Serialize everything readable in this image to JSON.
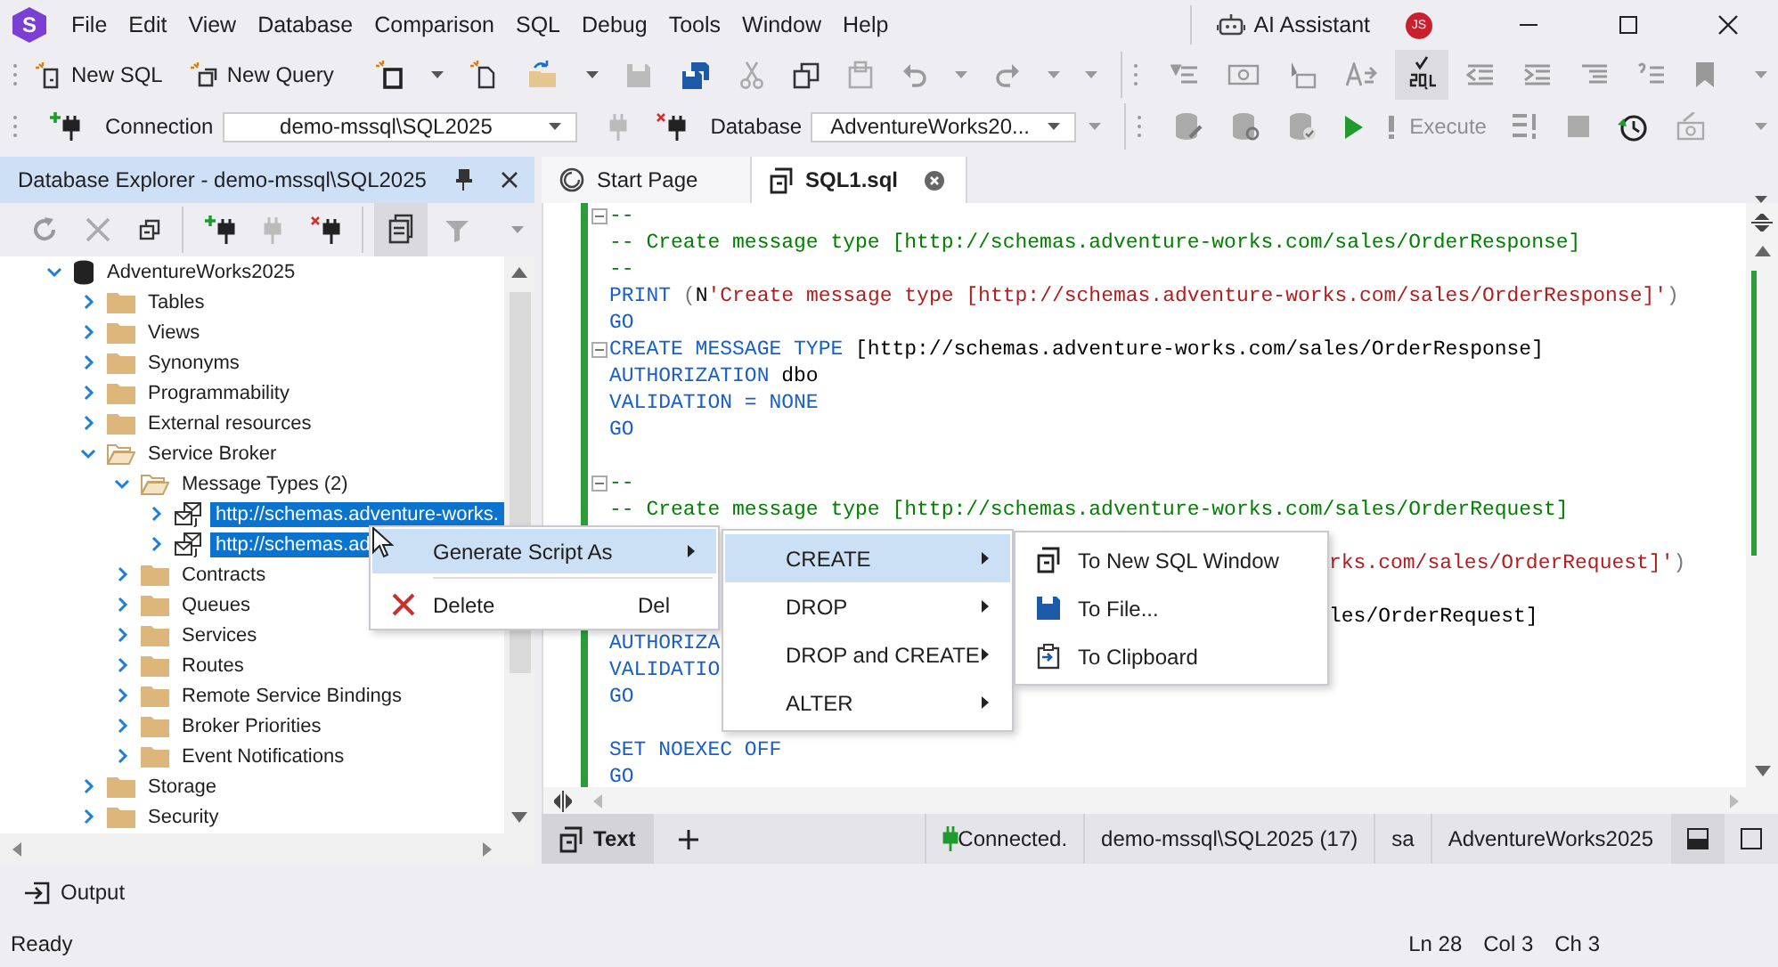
{
  "title_bar": {
    "logo": "S",
    "menu": [
      "File",
      "Edit",
      "View",
      "Database",
      "Comparison",
      "SQL",
      "Debug",
      "Tools",
      "Window",
      "Help"
    ],
    "assistant": "AI Assistant",
    "avatar": "JS"
  },
  "toolbar": {
    "new_sql": "New SQL",
    "new_query": "New Query",
    "connection_label": "Connection",
    "connection": "demo-mssql\\SQL2025",
    "database_label": "Database",
    "database": "AdventureWorks20...",
    "execute": {
      "label": "Execute",
      "disabled": true
    }
  },
  "explorer": {
    "title": "Database Explorer - demo-mssql\\SQL2025",
    "tree": [
      {
        "label": "AdventureWorks2025",
        "kind": "database",
        "expanded": true,
        "selected": false,
        "children": [
          {
            "label": "Tables",
            "kind": "folder",
            "expanded": false,
            "selected": false
          },
          {
            "label": "Views",
            "kind": "folder",
            "expanded": false,
            "selected": false
          },
          {
            "label": "Synonyms",
            "kind": "folder",
            "expanded": false,
            "selected": false
          },
          {
            "label": "Programmability",
            "kind": "folder",
            "expanded": false,
            "selected": false
          },
          {
            "label": "External resources",
            "kind": "folder",
            "expanded": false,
            "selected": false
          },
          {
            "label": "Service Broker",
            "kind": "folder",
            "expanded": true,
            "selected": false,
            "children": [
              {
                "label": "Message Types (2)",
                "kind": "folder",
                "expanded": true,
                "selected": false,
                "children": [
                  {
                    "label": "http://schemas.adventure-works.",
                    "kind": "message_type",
                    "expanded": false,
                    "selected": true
                  },
                  {
                    "label": "http://schemas.ad",
                    "kind": "message_type",
                    "expanded": false,
                    "selected": true
                  }
                ]
              },
              {
                "label": "Contracts",
                "kind": "folder",
                "expanded": false,
                "selected": false
              },
              {
                "label": "Queues",
                "kind": "folder",
                "expanded": false,
                "selected": false
              },
              {
                "label": "Services",
                "kind": "folder",
                "expanded": false,
                "selected": false
              },
              {
                "label": "Routes",
                "kind": "folder",
                "expanded": false,
                "selected": false
              },
              {
                "label": "Remote Service Bindings",
                "kind": "folder",
                "expanded": false,
                "selected": false
              },
              {
                "label": "Broker Priorities",
                "kind": "folder",
                "expanded": false,
                "selected": false
              },
              {
                "label": "Event Notifications",
                "kind": "folder",
                "expanded": false,
                "selected": false
              }
            ]
          },
          {
            "label": "Storage",
            "kind": "folder",
            "expanded": false,
            "selected": false
          },
          {
            "label": "Security",
            "kind": "folder",
            "expanded": false,
            "selected": false
          }
        ]
      }
    ]
  },
  "tabs": [
    {
      "label": "Start Page",
      "selected": false
    },
    {
      "label": "SQL1.sql",
      "selected": true
    }
  ],
  "editor": {
    "lines": [
      {
        "kind": "fold",
        "segments": [
          {
            "kind": "comment",
            "text": "--"
          }
        ]
      },
      {
        "kind": "code",
        "segments": [
          {
            "kind": "comment",
            "text": "-- Create message type [http://schemas.adventure-works.com/sales/OrderResponse]"
          }
        ]
      },
      {
        "kind": "code",
        "segments": [
          {
            "kind": "comment",
            "text": "--"
          }
        ]
      },
      {
        "kind": "code",
        "segments": [
          {
            "kind": "keyword",
            "text": "PRINT"
          },
          {
            "kind": "punct",
            "text": " ("
          },
          {
            "kind": "plain",
            "text": "N"
          },
          {
            "kind": "string",
            "text": "'Create message type [http://schemas.adventure-works.com/sales/OrderResponse]'"
          },
          {
            "kind": "punct",
            "text": ")"
          }
        ]
      },
      {
        "kind": "code",
        "segments": [
          {
            "kind": "keyword",
            "text": "GO"
          }
        ]
      },
      {
        "kind": "fold",
        "segments": [
          {
            "kind": "keyword",
            "text": "CREATE MESSAGE TYPE"
          },
          {
            "kind": "plain",
            "text": " [http://schemas.adventure-works.com/sales/OrderResponse]"
          }
        ]
      },
      {
        "kind": "code",
        "segments": [
          {
            "kind": "keyword",
            "text": "AUTHORIZATION"
          },
          {
            "kind": "plain",
            "text": " dbo"
          }
        ]
      },
      {
        "kind": "code",
        "segments": [
          {
            "kind": "keyword",
            "text": "VALIDATION = NONE"
          }
        ]
      },
      {
        "kind": "code",
        "segments": [
          {
            "kind": "keyword",
            "text": "GO"
          }
        ]
      },
      {
        "kind": "blank"
      },
      {
        "kind": "fold",
        "segments": [
          {
            "kind": "comment",
            "text": "--"
          }
        ]
      },
      {
        "kind": "code",
        "segments": [
          {
            "kind": "comment",
            "text": "-- Create message type [http://schemas.adventure-works.com/sales/OrderRequest]"
          }
        ]
      },
      {
        "kind": "blank"
      },
      {
        "kind": "tail",
        "segments": [
          {
            "kind": "string",
            "text": "rks.com/sales/OrderRequest]'"
          },
          {
            "kind": "punct",
            "text": ")"
          }
        ]
      },
      {
        "kind": "blank"
      },
      {
        "kind": "tail",
        "segments": [
          {
            "kind": "plain",
            "text": "les/OrderRequest]"
          }
        ]
      },
      {
        "kind": "code",
        "segments": [
          {
            "kind": "keyword",
            "text": "AUTHORIZA"
          }
        ]
      },
      {
        "kind": "code",
        "segments": [
          {
            "kind": "keyword",
            "text": "VALIDATIO"
          }
        ]
      },
      {
        "kind": "code",
        "segments": [
          {
            "kind": "keyword",
            "text": "GO"
          }
        ]
      },
      {
        "kind": "blank"
      },
      {
        "kind": "code",
        "segments": [
          {
            "kind": "keyword",
            "text": "SET NOEXEC OFF"
          }
        ]
      },
      {
        "kind": "code",
        "segments": [
          {
            "kind": "keyword",
            "text": "GO"
          }
        ]
      }
    ]
  },
  "result_bar": {
    "tabs": [
      {
        "label": "Text",
        "selected": true
      }
    ],
    "connection": "Connected.",
    "server": "demo-mssql\\SQL2025 (17)",
    "user": "sa",
    "database": "AdventureWorks2025"
  },
  "output": "Output",
  "status_bar": {
    "state": "Ready",
    "line": "Ln 28",
    "col": "Col 3",
    "ch": "Ch 3"
  },
  "context_menu": [
    {
      "label": "Generate Script As",
      "submenu": true,
      "selected": true
    },
    {
      "label": "Delete",
      "shortcut": "Del",
      "submenu": false,
      "selected": false
    }
  ],
  "submenu": [
    {
      "label": "CREATE",
      "submenu": true,
      "selected": true
    },
    {
      "label": "DROP",
      "submenu": true,
      "selected": false
    },
    {
      "label": "DROP and CREATE",
      "submenu": true,
      "selected": false
    },
    {
      "label": "ALTER",
      "submenu": true,
      "selected": false
    }
  ],
  "submenu_2": [
    {
      "label": "To New SQL Window",
      "selected": false
    },
    {
      "label": "To File...",
      "selected": false
    },
    {
      "label": "To Clipboard",
      "selected": false
    }
  ]
}
